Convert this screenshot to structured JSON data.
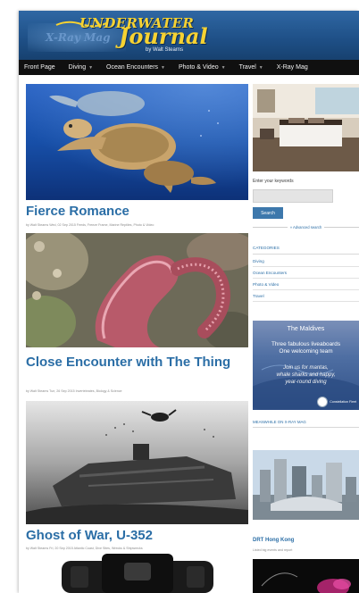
{
  "header": {
    "logo_top": "UNDERWATER",
    "logo_main": "Journal",
    "logo_xray": "X-Ray Mag",
    "logo_by": "by Walt Stearns"
  },
  "nav": {
    "items": [
      {
        "label": "Front Page",
        "has_dropdown": false
      },
      {
        "label": "Diving",
        "has_dropdown": true
      },
      {
        "label": "Ocean Encounters",
        "has_dropdown": true
      },
      {
        "label": "Photo & Video",
        "has_dropdown": true
      },
      {
        "label": "Travel",
        "has_dropdown": true
      },
      {
        "label": "X-Ray Mag",
        "has_dropdown": false
      }
    ]
  },
  "posts": [
    {
      "title": "Fierce Romance",
      "meta": "by Walt Stearns    Wed, 02 Sep 2015    Feeds, Freeze Frame, Marine Reptiles, Photo & Video"
    },
    {
      "title": "Close Encounter with The Thing",
      "meta": "by Walt Stearns    Tue, 26 Sep 2015    Invertebrates, Biology & Science"
    },
    {
      "title": "Ghost of War, U-352",
      "meta": "by Walt Stearns    Fri, 20 Sep 2015    Atlantic Coast, Dive Sites, Wrecks & Shipwrecks"
    }
  ],
  "sidebar": {
    "search_label": "Enter your keywords",
    "search_placeholder": "",
    "search_button": "Search",
    "advanced_search": "» Advanced search",
    "categories_heading": "CATEGORIES",
    "categories": [
      "Diving",
      "Ocean Encounters",
      "Photo & Video",
      "Travel"
    ],
    "ad": {
      "title": "The Maldives",
      "line1": "Three fabulous liveaboards",
      "line2": "One welcoming team",
      "line3": "Join us for mantas,",
      "line4": "whale sharks and happy,",
      "line5": "year-round diving",
      "brand": "Constellation Fleet"
    },
    "meanwhile_heading": "MEANWHILE ON X-RAY MAG",
    "feature_title": "DRT Hong Kong",
    "feature_sub": "Listed big events and report"
  }
}
